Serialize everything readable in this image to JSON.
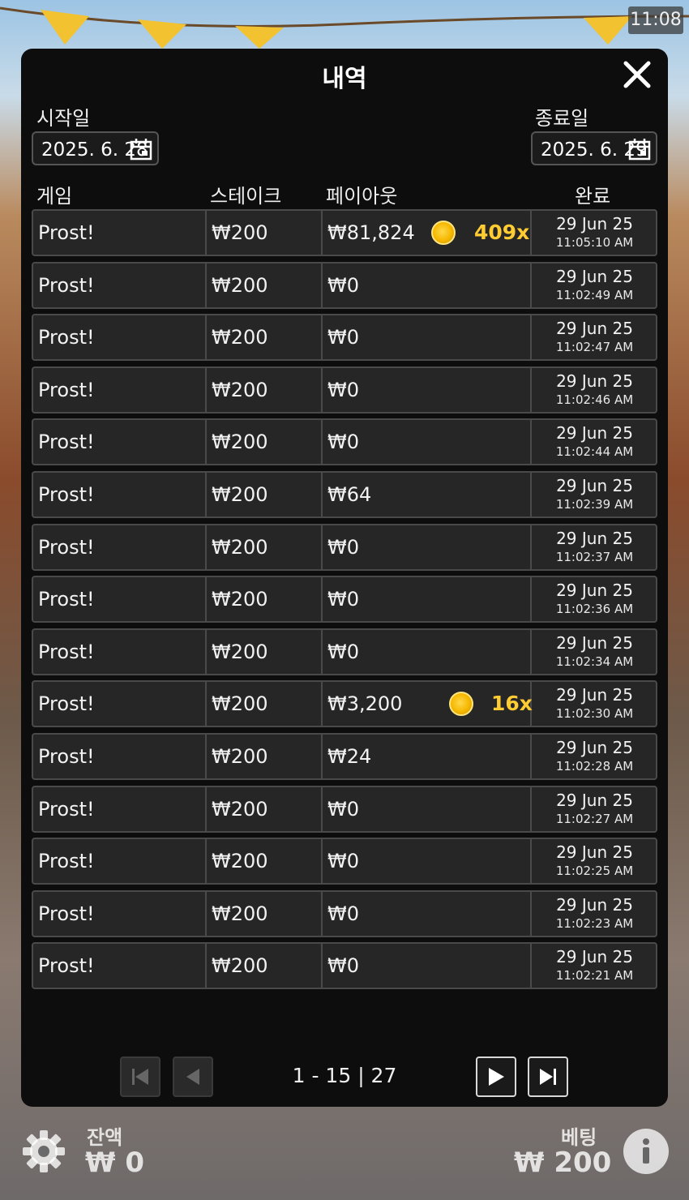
{
  "status_bar": {
    "time": "11:08"
  },
  "dialog": {
    "title": "내역",
    "start_label": "시작일",
    "start_date": "2025. 6. 28",
    "end_label": "종료일",
    "end_date": "2025. 6. 29",
    "columns": {
      "game": "게임",
      "stake": "스테이크",
      "payout": "페이아웃",
      "completed": "완료"
    },
    "rows": [
      {
        "game": "Prost!",
        "stake": "₩200",
        "payout": "₩81,824",
        "multiplier": "409x",
        "date": "29 Jun 25",
        "time": "11:05:10 AM"
      },
      {
        "game": "Prost!",
        "stake": "₩200",
        "payout": "₩0",
        "multiplier": "",
        "date": "29 Jun 25",
        "time": "11:02:49 AM"
      },
      {
        "game": "Prost!",
        "stake": "₩200",
        "payout": "₩0",
        "multiplier": "",
        "date": "29 Jun 25",
        "time": "11:02:47 AM"
      },
      {
        "game": "Prost!",
        "stake": "₩200",
        "payout": "₩0",
        "multiplier": "",
        "date": "29 Jun 25",
        "time": "11:02:46 AM"
      },
      {
        "game": "Prost!",
        "stake": "₩200",
        "payout": "₩0",
        "multiplier": "",
        "date": "29 Jun 25",
        "time": "11:02:44 AM"
      },
      {
        "game": "Prost!",
        "stake": "₩200",
        "payout": "₩64",
        "multiplier": "",
        "date": "29 Jun 25",
        "time": "11:02:39 AM"
      },
      {
        "game": "Prost!",
        "stake": "₩200",
        "payout": "₩0",
        "multiplier": "",
        "date": "29 Jun 25",
        "time": "11:02:37 AM"
      },
      {
        "game": "Prost!",
        "stake": "₩200",
        "payout": "₩0",
        "multiplier": "",
        "date": "29 Jun 25",
        "time": "11:02:36 AM"
      },
      {
        "game": "Prost!",
        "stake": "₩200",
        "payout": "₩0",
        "multiplier": "",
        "date": "29 Jun 25",
        "time": "11:02:34 AM"
      },
      {
        "game": "Prost!",
        "stake": "₩200",
        "payout": "₩3,200",
        "multiplier": "16x",
        "date": "29 Jun 25",
        "time": "11:02:30 AM"
      },
      {
        "game": "Prost!",
        "stake": "₩200",
        "payout": "₩24",
        "multiplier": "",
        "date": "29 Jun 25",
        "time": "11:02:28 AM"
      },
      {
        "game": "Prost!",
        "stake": "₩200",
        "payout": "₩0",
        "multiplier": "",
        "date": "29 Jun 25",
        "time": "11:02:27 AM"
      },
      {
        "game": "Prost!",
        "stake": "₩200",
        "payout": "₩0",
        "multiplier": "",
        "date": "29 Jun 25",
        "time": "11:02:25 AM"
      },
      {
        "game": "Prost!",
        "stake": "₩200",
        "payout": "₩0",
        "multiplier": "",
        "date": "29 Jun 25",
        "time": "11:02:23 AM"
      },
      {
        "game": "Prost!",
        "stake": "₩200",
        "payout": "₩0",
        "multiplier": "",
        "date": "29 Jun 25",
        "time": "11:02:21 AM"
      }
    ],
    "pagination": {
      "label": "1 - 15 | 27"
    }
  },
  "footer": {
    "balance_label": "잔액",
    "balance_value": "₩ 0",
    "bet_label": "베팅",
    "bet_value": "₩ 200"
  },
  "colors": {
    "multiplier": "#ffcc33",
    "panel": "#0d0d0d",
    "row": "#262626"
  }
}
